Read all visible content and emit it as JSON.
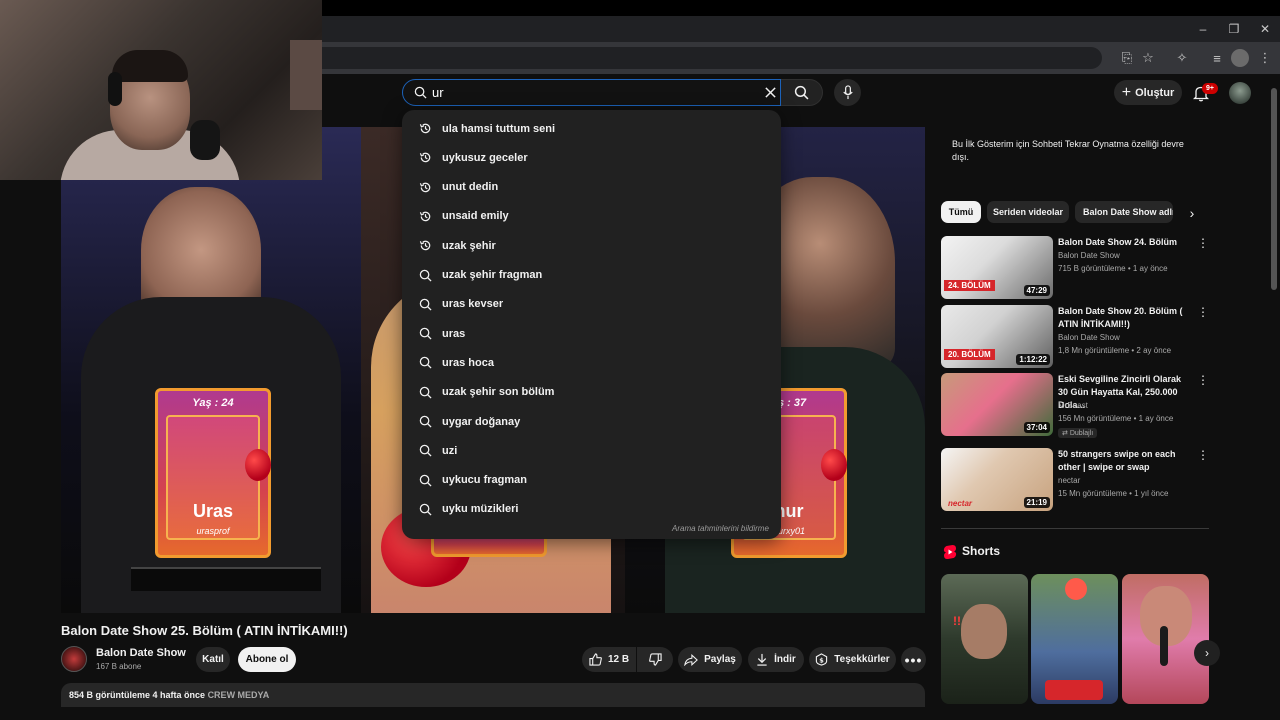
{
  "browser": {
    "window_controls": [
      "–",
      "❐",
      "✕"
    ]
  },
  "header": {
    "search_value": "ur",
    "create_label": "Oluştur",
    "notification_count": "9+"
  },
  "suggestions": {
    "items": [
      {
        "type": "history",
        "text": "ula hamsi tuttum seni"
      },
      {
        "type": "history",
        "text": "uykusuz geceler"
      },
      {
        "type": "history",
        "text": "unut dedin"
      },
      {
        "type": "history",
        "text": "unsaid emily"
      },
      {
        "type": "history",
        "text": "uzak şehir"
      },
      {
        "type": "search",
        "text": "uzak şehir fragman"
      },
      {
        "type": "search",
        "text": "uras kevser"
      },
      {
        "type": "search",
        "text": "uras"
      },
      {
        "type": "search",
        "text": "uras hoca"
      },
      {
        "type": "search",
        "text": "uzak şehir son bölüm"
      },
      {
        "type": "search",
        "text": "uygar doğanay"
      },
      {
        "type": "search",
        "text": "uzi"
      },
      {
        "type": "search",
        "text": "uykucu fragman"
      },
      {
        "type": "search",
        "text": "uyku müzikleri"
      }
    ],
    "report_label": "Arama tahminlerini bildirme"
  },
  "player": {
    "cards": [
      {
        "age": "Yaş : 24",
        "name": "Uras",
        "handle": "urasprof"
      },
      {
        "age": "",
        "name": "",
        "handle": ""
      },
      {
        "age": "aş : 37",
        "name": "hur",
        "handle": "nurxy01"
      }
    ]
  },
  "video": {
    "title": "Balon Date Show 25. Bölüm ( ATIN İNTİKAMI!!)",
    "channel": "Balon Date Show",
    "subscribers": "167 B abone",
    "join_label": "Katıl",
    "subscribe_label": "Abone ol",
    "likes": "12 B",
    "share_label": "Paylaş",
    "download_label": "İndir",
    "thanks_label": "Teşekkürler",
    "views_line": "854 B görüntüleme  4 hafta önce",
    "tag": "CREW MEDYA"
  },
  "sidebar": {
    "chat_note": "Bu İlk Gösterim için Sohbeti Tekrar Oynatma özelliği devre dışı.",
    "chips": [
      "Tümü",
      "Seriden videolar",
      "Balon Date Show adlı"
    ],
    "recommendations": [
      {
        "title": "Balon Date Show 24. Bölüm",
        "channel": "Balon Date Show",
        "meta": "715 B görüntüleme • 1 ay önce",
        "duration": "47:29",
        "thumb_tag": "24. BÖLÜM",
        "badge": ""
      },
      {
        "title": "Balon Date Show 20. Bölüm ( ATIN İNTİKAMI!!)",
        "channel": "Balon Date Show",
        "meta": "1,8 Mn görüntüleme • 2 ay önce",
        "duration": "1:12:22",
        "thumb_tag": "20. BÖLÜM",
        "badge": ""
      },
      {
        "title": "Eski Sevgiline Zincirli Olarak 30 Gün Hayatta Kal, 250.000 Dola...",
        "channel": "MrBeast",
        "meta": "156 Mn görüntüleme • 1 ay önce",
        "duration": "37:04",
        "thumb_tag": "",
        "badge": "Dublajlı"
      },
      {
        "title": "50 strangers swipe on each other | swipe or swap",
        "channel": "nectar",
        "meta": "15 Mn görüntüleme • 1 yıl önce",
        "duration": "21:19",
        "thumb_tag": "nectar",
        "badge": ""
      }
    ],
    "shorts_title": "Shorts"
  },
  "colors": {
    "background": "#0f0f0f",
    "accent_red": "#cc0000",
    "search_focus": "#1c62b9"
  }
}
